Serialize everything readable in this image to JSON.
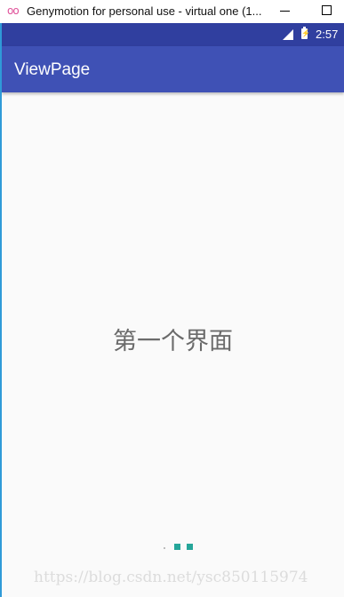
{
  "window": {
    "title": "Genymotion for personal use - virtual one (1...",
    "logo_text": "oo",
    "logo_color": "#e0529a"
  },
  "status_bar": {
    "time": "2:57",
    "icons": [
      "signal-icon",
      "battery-charging-icon"
    ],
    "color": "#303f9f"
  },
  "app_bar": {
    "title": "ViewPage",
    "color": "#3f51b5"
  },
  "page": {
    "text": "第一个界面"
  },
  "page_indicator": {
    "count": 3,
    "accent": "#26a69a"
  },
  "watermark": "https://blog.csdn.net/ysc850115974"
}
